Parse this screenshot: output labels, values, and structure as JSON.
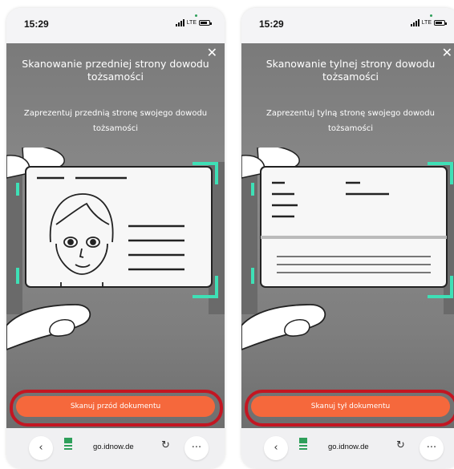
{
  "screens": [
    {
      "time": "15:29",
      "network": "LTE",
      "title": "Skanowanie przedniej strony dowodu tożsamości",
      "subtitle": "Zaprezentuj przednią stronę swojego dowodu tożsamości",
      "button": "Skanuj przód dokumentu",
      "url": "go.idnow.de",
      "side": "front"
    },
    {
      "time": "15:29",
      "network": "LTE",
      "title": "Skanowanie tylnej strony dowodu tożsamości",
      "subtitle": "Zaprezentuj tylną stronę swojego dowodu tożsamości",
      "button": "Skanuj tył dokumentu",
      "url": "go.idnow.de",
      "side": "back"
    }
  ],
  "colors": {
    "cta": "#f5683c",
    "highlight_ring": "#c31622",
    "frame_corners": "#3ee0b6"
  },
  "icons": {
    "close": "close-icon",
    "back": "chevron-left-icon",
    "reload": "reload-icon",
    "more": "more-icon",
    "site": "site-icon"
  }
}
